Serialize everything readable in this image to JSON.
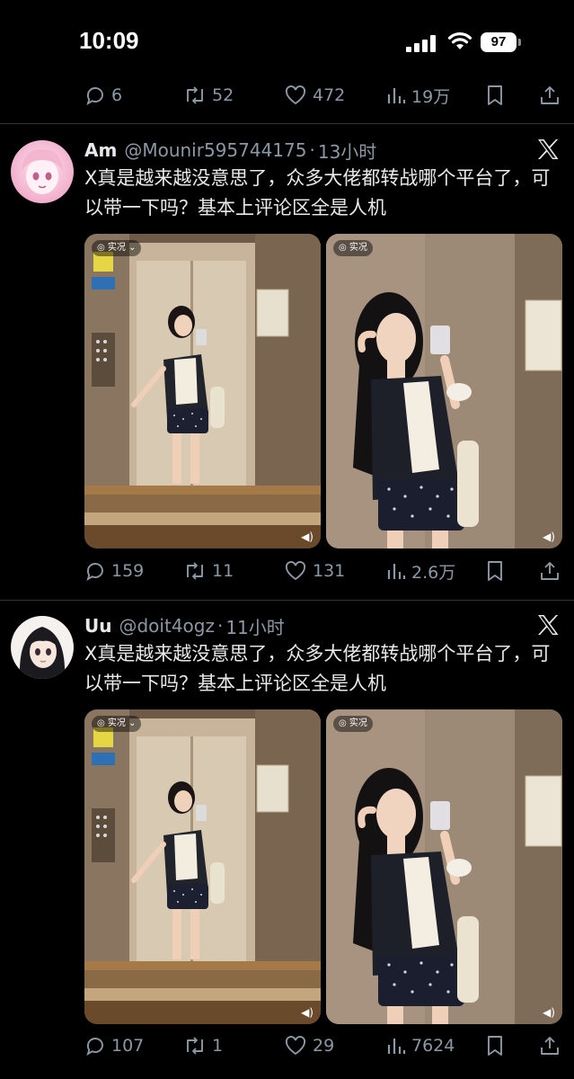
{
  "status_bar": {
    "time": "10:09",
    "battery": "97"
  },
  "prev_tweet_actions": {
    "replies": "6",
    "retweets": "52",
    "likes": "472",
    "views": "19万"
  },
  "tweets": [
    {
      "name": "Am",
      "handle": "@Mounir595744175",
      "separator": "·",
      "time_ago": "13小时",
      "text": "X真是越来越没意思了，众多大佬都转战哪个平台了，可以带一下吗？基本上评论区全是人机",
      "live_label": "实况",
      "actions": {
        "replies": "159",
        "retweets": "11",
        "likes": "131",
        "views": "2.6万"
      }
    },
    {
      "name": "Uu",
      "handle": "@doit4ogz",
      "separator": "·",
      "time_ago": "11小时",
      "text": "X真是越来越没意思了，众多大佬都转战哪个平台了，可以带一下吗？基本上评论区全是人机",
      "live_label": "实况",
      "actions": {
        "replies": "107",
        "retweets": "1",
        "likes": "29",
        "views": "7624"
      }
    }
  ],
  "colors": {
    "background": "#000000",
    "text": "#e7e9ea",
    "muted": "#8b98a5",
    "divider": "#2f3336"
  },
  "icons": [
    "reply-icon",
    "retweet-icon",
    "like-icon",
    "views-icon",
    "bookmark-icon",
    "share-icon",
    "x-logo-icon",
    "speaker-icon"
  ]
}
